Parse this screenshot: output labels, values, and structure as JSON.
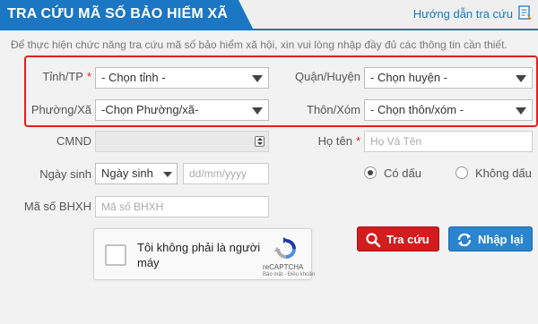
{
  "header": {
    "title": "TRA CỨU MÃ SỐ BẢO HIỂM XÃ HỘI",
    "guide_link": "Hướng dẫn tra cứu"
  },
  "intro": "Để thực hiện chức năng tra cứu mã số bảo hiểm xã hội, xin vui lòng nhập đầy đủ các thông tin cần thiết.",
  "location": {
    "province": {
      "label": "Tỉnh/TP",
      "required": "*",
      "value": "- Chọn tỉnh -"
    },
    "district": {
      "label": "Quận/Huyện",
      "value": "- Chọn huyện -"
    },
    "ward": {
      "label": "Phường/Xã",
      "value": "-Chọn Phường/xã-"
    },
    "village": {
      "label": "Thôn/Xóm",
      "value": "- Chọn thôn/xóm -"
    }
  },
  "form": {
    "cmnd": {
      "label": "CMND",
      "value": ""
    },
    "fullname": {
      "label": "Họ tên",
      "required": "*",
      "placeholder": "Họ Và Tên"
    },
    "birth": {
      "label": "Ngày sinh",
      "type_value": "Ngày sinh",
      "placeholder": "dd/mm/yyyy"
    },
    "accent": {
      "option_with": "Có dấu",
      "option_without": "Không dấu",
      "selected": "Có dấu"
    },
    "bhxh": {
      "label": "Mã số BHXH",
      "placeholder": "Mã số BHXH"
    }
  },
  "captcha": {
    "label": "Tôi không phải là người máy",
    "brand": "reCAPTCHA",
    "links": "Bảo mật - Điều khoản"
  },
  "actions": {
    "search": "Tra cứu",
    "reset": "Nhập lại"
  },
  "colors": {
    "brand_blue": "#1b76c4",
    "danger_red": "#d11d1d",
    "highlight_red": "#e02020",
    "reset_blue": "#2a85cf"
  },
  "icons": {
    "guide": "help-document-icon",
    "search": "search-icon",
    "reset": "refresh-icon",
    "captcha": "recaptcha-logo-icon"
  }
}
